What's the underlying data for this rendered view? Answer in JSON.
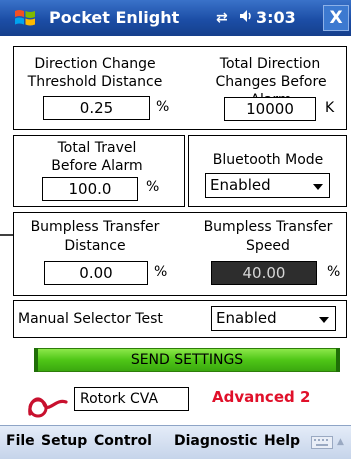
{
  "titlebar": {
    "app_title": "Pocket Enlight",
    "clock": "3:03",
    "close_label": "X",
    "conn_glyph": "⇄",
    "vol_glyph": "◀("
  },
  "direction_change": {
    "label_line1": "Direction Change",
    "label_line2": "Threshold Distance",
    "value": "0.25",
    "unit": "%"
  },
  "total_direction": {
    "label_line1": "Total Direction",
    "label_line2": "Changes Before Alarm",
    "value": "10000",
    "unit": "K"
  },
  "total_travel": {
    "label_line1": "Total Travel",
    "label_line2": "Before Alarm",
    "value": "100.0",
    "unit": "%"
  },
  "bluetooth": {
    "label": "Bluetooth Mode",
    "selected": "Enabled"
  },
  "bumpless_distance": {
    "label_line1": "Bumpless Transfer",
    "label_line2": "Distance",
    "value": "0.00",
    "unit": "%"
  },
  "bumpless_speed": {
    "label_line1": "Bumpless Transfer",
    "label_line2": "Speed",
    "value": "40.00",
    "unit": "%"
  },
  "manual_selector": {
    "label": "Manual Selector Test",
    "selected": "Enabled"
  },
  "send_button": {
    "label": "SEND SETTINGS"
  },
  "device": {
    "name": "Rotork CVA"
  },
  "mode": {
    "label": "Advanced 2"
  },
  "menu": {
    "file": "File",
    "setup": "Setup",
    "control": "Control",
    "diagnostic": "Diagnostic",
    "help": "Help"
  },
  "colors": {
    "titlebar": "#1c4ea6",
    "send_button": "#4fc617",
    "mode_text": "#e0102a",
    "rotork_logo": "#c8102e"
  },
  "icons": [
    "windows-logo-icon",
    "connectivity-icon",
    "volume-icon",
    "rotork-logo-icon",
    "keyboard-icon",
    "arrow-marker-icon"
  ]
}
